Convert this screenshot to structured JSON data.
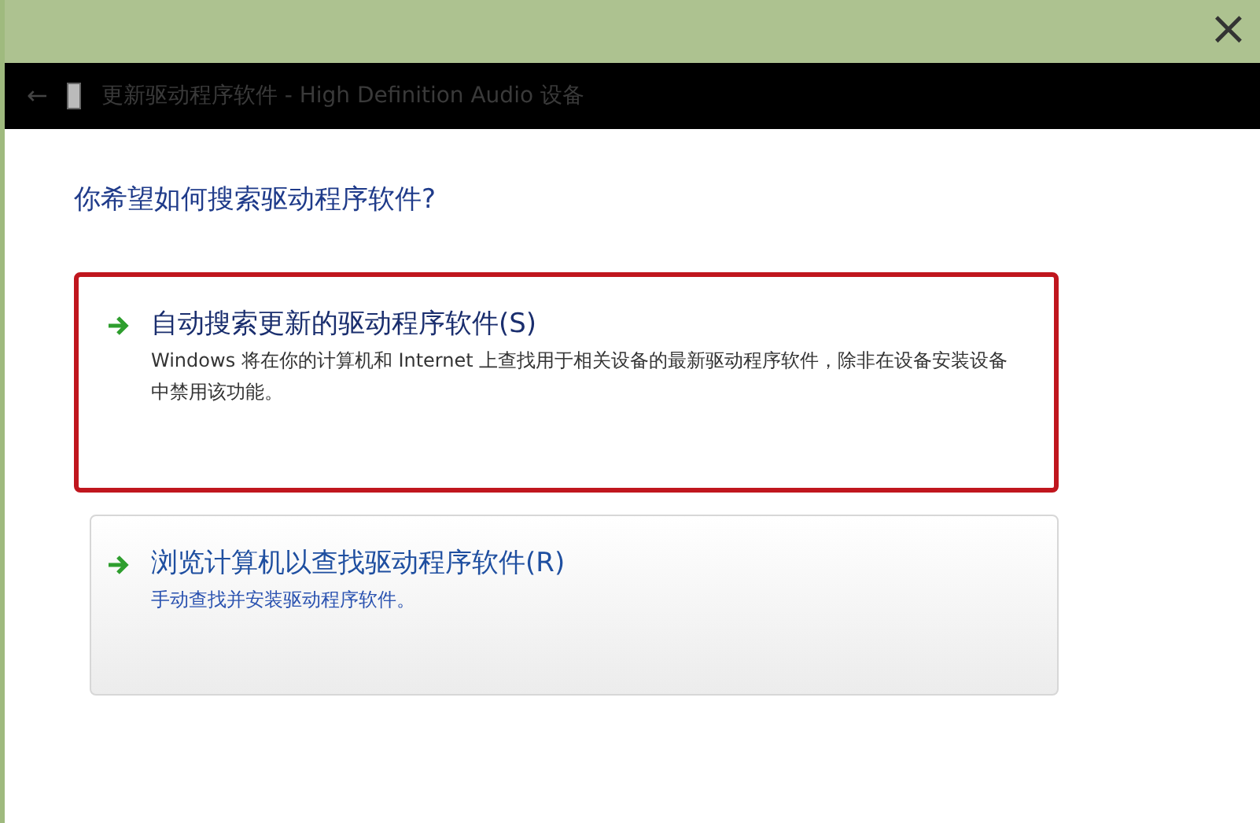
{
  "window": {
    "close": "×"
  },
  "header": {
    "back": "←",
    "title": "更新驱动程序软件 - High Definition Audio 设备"
  },
  "question": "你希望如何搜索驱动程序软件?",
  "options": [
    {
      "title": "自动搜索更新的驱动程序软件(S)",
      "description": "Windows 将在你的计算机和 Internet 上查找用于相关设备的最新驱动程序软件，除非在设备安装设备中禁用该功能。",
      "highlighted": true,
      "hovered": false
    },
    {
      "title": "浏览计算机以查找驱动程序软件(R)",
      "description": "手动查找并安装驱动程序软件。",
      "highlighted": false,
      "hovered": true
    }
  ]
}
